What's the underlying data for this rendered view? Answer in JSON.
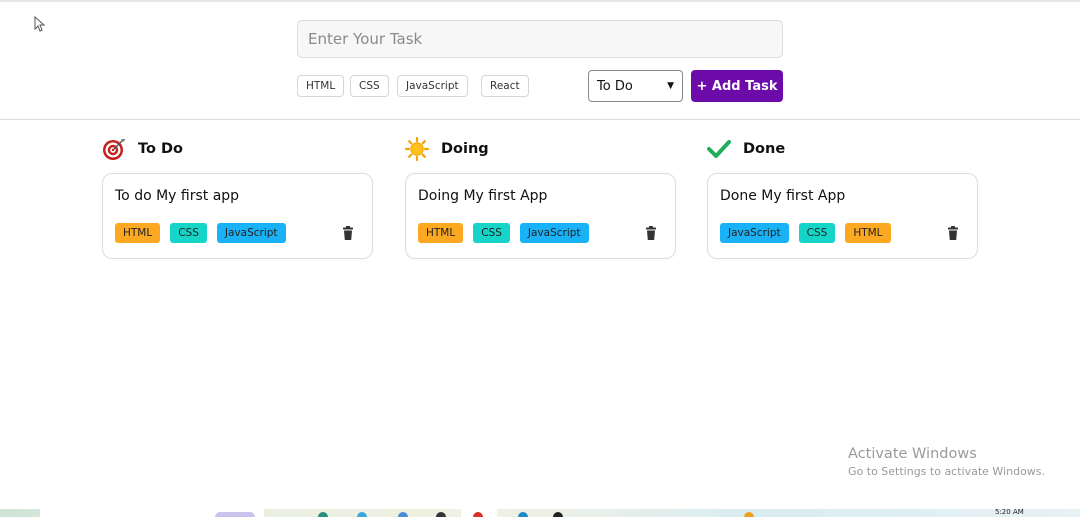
{
  "task_form": {
    "input_placeholder": "Enter Your Task",
    "input_value": "",
    "tags": [
      "HTML",
      "CSS",
      "JavaScript",
      "React"
    ],
    "status_select": {
      "selected": "To Do"
    },
    "add_button_label": "+ Add Task"
  },
  "columns": [
    {
      "title": "To Do",
      "icon": "target-icon",
      "cards": [
        {
          "text": "To do My first app",
          "tags": [
            "HTML",
            "CSS",
            "JavaScript"
          ]
        }
      ]
    },
    {
      "title": "Doing",
      "icon": "sun-icon",
      "cards": [
        {
          "text": "Doing My first App",
          "tags": [
            "HTML",
            "CSS",
            "JavaScript"
          ]
        }
      ]
    },
    {
      "title": "Done",
      "icon": "checkmark-icon",
      "cards": [
        {
          "text": "Done My first App",
          "tags": [
            "JavaScript",
            "CSS",
            "HTML"
          ]
        }
      ]
    }
  ],
  "tag_colors": {
    "HTML": "#fda821",
    "CSS": "#15d4c8",
    "JavaScript": "#1ab2f7"
  },
  "accent_color": "#6c0ba9",
  "watermark": {
    "title": "Activate Windows",
    "subtitle": "Go to Settings to activate Windows."
  },
  "taskbar": {
    "time": "5:20 AM"
  }
}
